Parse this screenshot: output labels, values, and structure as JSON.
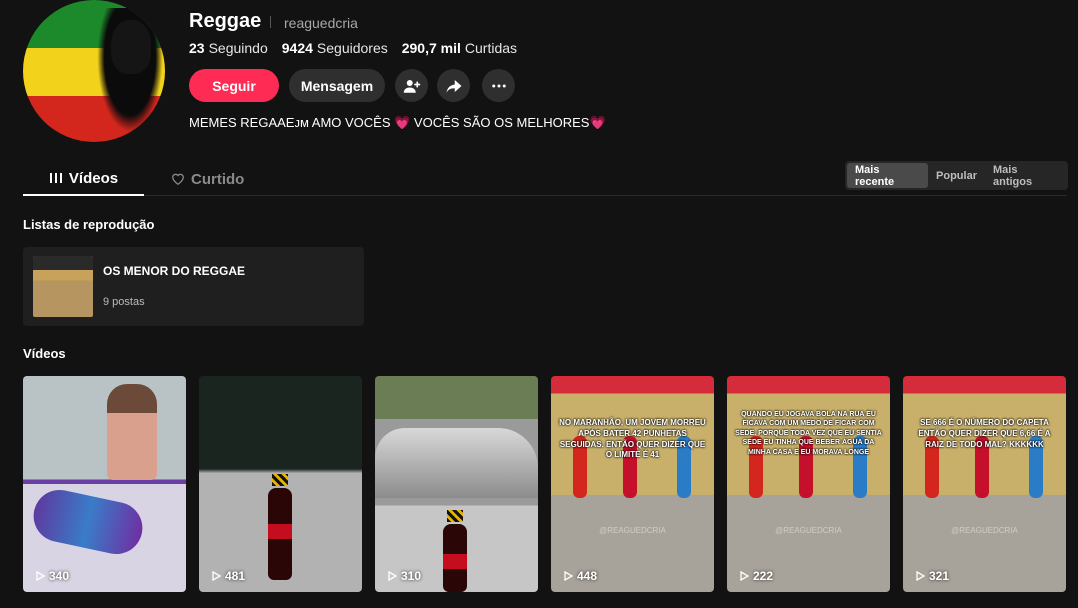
{
  "profile": {
    "name": "Reggae",
    "handle": "reaguedcria",
    "following_count": "23",
    "following_label": "Seguindo",
    "followers_count": "9424",
    "followers_label": "Seguidores",
    "likes_count": "290,7 mil",
    "likes_label": "Curtidas",
    "bio": "MEMES REGAAEᴊᴍ AMO VOCÊS 💗 VOCÊS SÃO OS MELHORES💗"
  },
  "actions": {
    "follow_label": "Seguir",
    "message_label": "Mensagem",
    "add_friend_icon": "add-user-icon",
    "share_icon": "share-icon",
    "more_icon": "more-icon"
  },
  "tabs": [
    {
      "label": "Vídeos",
      "icon": "grid-icon",
      "active": true
    },
    {
      "label": "Curtido",
      "icon": "heart-icon",
      "active": false
    }
  ],
  "sort": {
    "options": [
      "Mais recente",
      "Popular",
      "Mais antigos"
    ],
    "selected": "Mais recente"
  },
  "playlists": {
    "section_title": "Listas de reprodução",
    "items": [
      {
        "title": "OS MENOR DO REGGAE",
        "count": "9 postas"
      }
    ]
  },
  "videos": {
    "section_title": "Vídeos",
    "items": [
      {
        "views": "340",
        "caption": ""
      },
      {
        "views": "481",
        "caption": ""
      },
      {
        "views": "310",
        "caption": ""
      },
      {
        "views": "448",
        "caption": "NO MARANHÃO, UM JOVEM MORREU APÓS BATER 42 PUNHETAS SEGUIDAS. ENTÃO QUER DIZER QUE O LIMITE É 41",
        "watermark": "@REAGUEDCRIA"
      },
      {
        "views": "222",
        "caption": "QUANDO EU JOGAVA BOLA NA RUA EU FICAVA COM UM MEDO DE FICAR COM SEDE. PORQUE TODA VEZ QUE EU SENTIA SEDE EU TINHA QUE BEBER ÁGUA DA MINHA CASA E EU MORAVA LONGE",
        "watermark": "@REAGUEDCRIA"
      },
      {
        "views": "321",
        "caption": "SE 666 É O NÚMERO DO CAPETA ENTÃO QUER DIZER QUE 6,66 É A RAIZ DE TODO MAL? KKKKKK",
        "watermark": "@REAGUEDCRIA"
      }
    ]
  },
  "colors": {
    "accent": "#fe2c55",
    "background": "#121212",
    "surface": "#1f1f1f"
  }
}
